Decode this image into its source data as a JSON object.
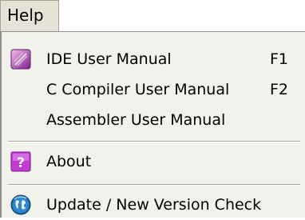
{
  "menu_title": "Help",
  "items": [
    {
      "label": "IDE User Manual",
      "shortcut": "F1",
      "icon": "manual-icon"
    },
    {
      "label": "C Compiler User Manual",
      "shortcut": "F2",
      "icon": ""
    },
    {
      "label": "Assembler User Manual",
      "shortcut": "",
      "icon": ""
    },
    {
      "label": "About",
      "shortcut": "",
      "icon": "help-question-icon"
    },
    {
      "label": "Update / New Version Check",
      "shortcut": "",
      "icon": "globe-update-icon"
    }
  ],
  "colors": {
    "menu_background": "#f2f2ec",
    "title_background": "#e6e3d6",
    "about_icon": "#c23bd2",
    "update_icon": "#1b6aa8"
  }
}
